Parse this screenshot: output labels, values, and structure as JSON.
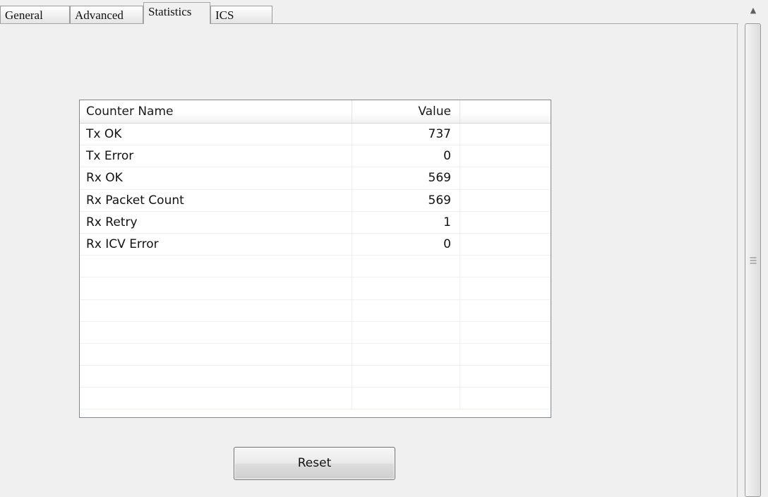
{
  "tabs": [
    {
      "label": "General"
    },
    {
      "label": "Advanced"
    },
    {
      "label": "Statistics"
    },
    {
      "label": "ICS"
    }
  ],
  "active_tab": "Statistics",
  "list": {
    "columns": {
      "name": "Counter Name",
      "value": "Value",
      "extra": ""
    },
    "rows": [
      {
        "name": "Tx OK",
        "value": "737"
      },
      {
        "name": "Tx Error",
        "value": "0"
      },
      {
        "name": "Rx OK",
        "value": "569"
      },
      {
        "name": "Rx Packet Count",
        "value": "569"
      },
      {
        "name": "Rx Retry",
        "value": "1"
      },
      {
        "name": "Rx ICV Error",
        "value": "0"
      },
      {
        "name": "",
        "value": ""
      },
      {
        "name": "",
        "value": ""
      },
      {
        "name": "",
        "value": ""
      },
      {
        "name": "",
        "value": ""
      },
      {
        "name": "",
        "value": ""
      },
      {
        "name": "",
        "value": ""
      },
      {
        "name": "",
        "value": ""
      }
    ]
  },
  "reset_button": {
    "label": "Reset"
  },
  "scrollbar": {
    "up_icon": "scroll-up-arrow",
    "grip_icon": "scroll-grip"
  }
}
